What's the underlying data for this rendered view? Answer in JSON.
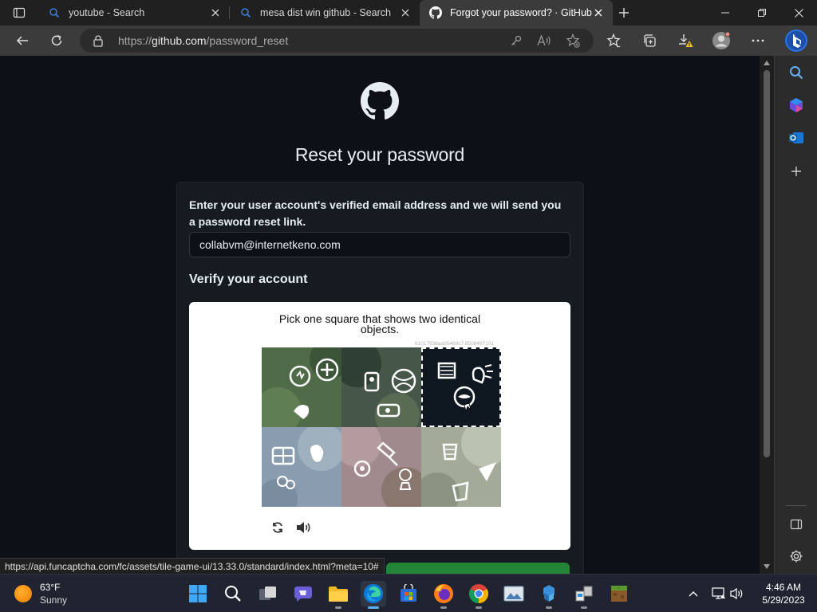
{
  "browser": {
    "tabs": [
      {
        "title": "youtube - Search",
        "favicon": "search-icon",
        "active": false
      },
      {
        "title": "mesa dist win github - Search",
        "favicon": "search-icon",
        "active": false
      },
      {
        "title": "Forgot your password? · GitHub",
        "favicon": "github-icon",
        "active": true
      }
    ],
    "address": {
      "protocol": "https://",
      "host": "github.com",
      "path": "/password_reset"
    }
  },
  "page": {
    "title": "Reset your password",
    "instructions": "Enter your user account's verified email address and we will send you a password reset link.",
    "email_value": "collabvm@internetkeno.com",
    "verify_heading": "Verify your account",
    "captcha": {
      "prompt": "Pick one square that shows two identical objects.",
      "session_id": "61017638aa95469c7.8508497101",
      "selected_tile": 3,
      "tiles": [
        {
          "index": 1,
          "bg": "#4f6b48"
        },
        {
          "index": 2,
          "bg": "#46574a"
        },
        {
          "index": 3,
          "bg": "#0f1720"
        },
        {
          "index": 4,
          "bg": "#8a9db0"
        },
        {
          "index": 5,
          "bg": "#a08a8e"
        },
        {
          "index": 6,
          "bg": "#a3ab98"
        }
      ]
    }
  },
  "status_url": "https://api.funcaptcha.com/fc/assets/tile-game-ui/13.33.0/standard/index.html?meta=10#",
  "taskbar": {
    "weather_temp": "63°F",
    "weather_cond": "Sunny",
    "time": "4:46 AM",
    "date": "5/29/2023"
  },
  "colors": {
    "page_bg": "#0d1117",
    "card_bg": "#161b22",
    "accent_green": "#238636",
    "text": "#e6edf3"
  }
}
